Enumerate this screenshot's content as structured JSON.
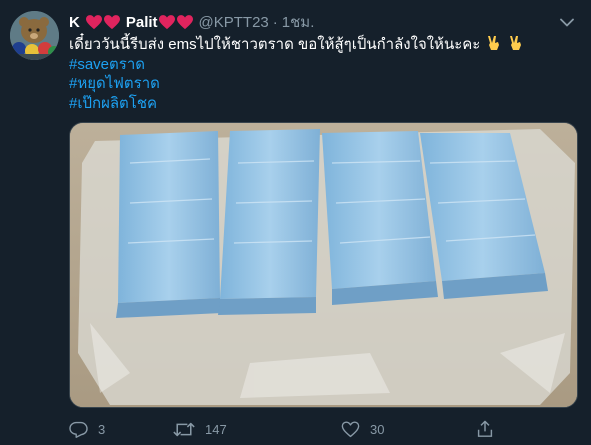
{
  "tweet": {
    "display_name": "K",
    "display_name_2": "Palit",
    "handle": "@KPTT23",
    "separator": "·",
    "time": "1ชม.",
    "text": "เดี๋ยววันนี้รีบส่ง emsไปให้ชาวตราด ขอให้สู้ๆเป็นกำลังใจให้นะคะ",
    "hashtags": [
      "#saveตราด",
      "#หยุดไฟตราด",
      "#เป๊กผลิตโชค"
    ]
  },
  "actions": {
    "reply_count": "3",
    "retweet_count": "147",
    "like_count": "30"
  },
  "colors": {
    "background": "#15202b",
    "accent": "#1da1f2",
    "muted": "#8899a6",
    "heart": "#e0245e"
  },
  "icons": {
    "caret": "chevron-down-icon",
    "reply": "reply-icon",
    "retweet": "retweet-icon",
    "like": "like-icon",
    "share": "share-icon",
    "emoji": "victory-hand-emoji"
  }
}
